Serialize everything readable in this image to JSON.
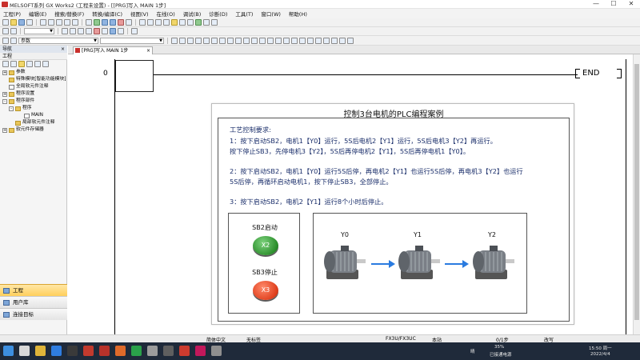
{
  "window": {
    "title": "MELSOFT系列 GX Works2 (工程未设置) - [[PRG]写入 MAIN 1步]",
    "min": "—",
    "max": "☐",
    "close": "✕"
  },
  "menu": [
    "工程(P)",
    "编辑(E)",
    "搜索/替换(F)",
    "转换/编译(C)",
    "视图(V)",
    "在线(O)",
    "调试(B)",
    "诊断(D)",
    "工具(T)",
    "窗口(W)",
    "帮助(H)"
  ],
  "toolbar": {
    "param_combo": "参数"
  },
  "nav": {
    "header": "导航",
    "close": "×",
    "section": "工程",
    "tree": [
      {
        "label": "参数",
        "indent": 0,
        "toggle": "+",
        "icon": "folder"
      },
      {
        "label": "特殊模块[智能功能模块]",
        "indent": 0,
        "toggle": "",
        "icon": "folder"
      },
      {
        "label": "全局软元件注释",
        "indent": 0,
        "toggle": "",
        "icon": "doc"
      },
      {
        "label": "程序设置",
        "indent": 0,
        "toggle": "+",
        "icon": "folder"
      },
      {
        "label": "程序部件",
        "indent": 0,
        "toggle": "-",
        "icon": "folder"
      },
      {
        "label": "程序",
        "indent": 1,
        "toggle": "-",
        "icon": "folder"
      },
      {
        "label": "MAIN",
        "indent": 2,
        "toggle": "",
        "icon": "doc"
      },
      {
        "label": "局部软元件注释",
        "indent": 1,
        "toggle": "",
        "icon": "folder"
      },
      {
        "label": "软元件存储器",
        "indent": 0,
        "toggle": "+",
        "icon": "folder"
      }
    ],
    "buttons": [
      "工程",
      "用户库",
      "连接目标"
    ]
  },
  "editor": {
    "tab_label": "[PRG]写入 MAIN 1步",
    "tab_close": "×",
    "step_number": "0",
    "end_label": "END"
  },
  "card": {
    "title": "控制3台电机的PLC编程案例",
    "requirements": [
      "工艺控制要求:",
      "1：按下启动SB2，电机1【Y0】运行，5S后电机2【Y1】运行，5S后电机3【Y2】再运行。",
      "   按下停止SB3，先停电机3【Y2】，5S后再停电机2【Y1】，5S后再停电机1【Y0】。",
      "2：按下启动SB2，电机1【Y0】运行5S后停，再电机2【Y1】也运行5S后停，再电机3【Y2】也运行",
      "   5S后停，再循环启动电机1，按下停止SB3，全部停止。",
      "3：按下启动SB2，电机2【Y1】运行8个小时后停止。"
    ],
    "start_label": "SB2启动",
    "start_btn": "X2",
    "stop_label": "SB3停止",
    "stop_btn": "X3",
    "motors": [
      "Y0",
      "Y1",
      "Y2"
    ]
  },
  "status": {
    "lang": "简体中文",
    "label": "无标签",
    "cpu": "FX3U/FX3UC",
    "station": "本站",
    "steps": "0/1步",
    "mode": "改写"
  },
  "taskbar": {
    "weather": "晴",
    "battery": "35%",
    "battery_sub": "已接通电源",
    "time": "15:50 周一",
    "date": "2022/4/4"
  },
  "colors": {
    "accent": "#1b2f6b",
    "green_button": "#2c8f2c",
    "red_button": "#e0401e",
    "arrow": "#2a7be0"
  }
}
